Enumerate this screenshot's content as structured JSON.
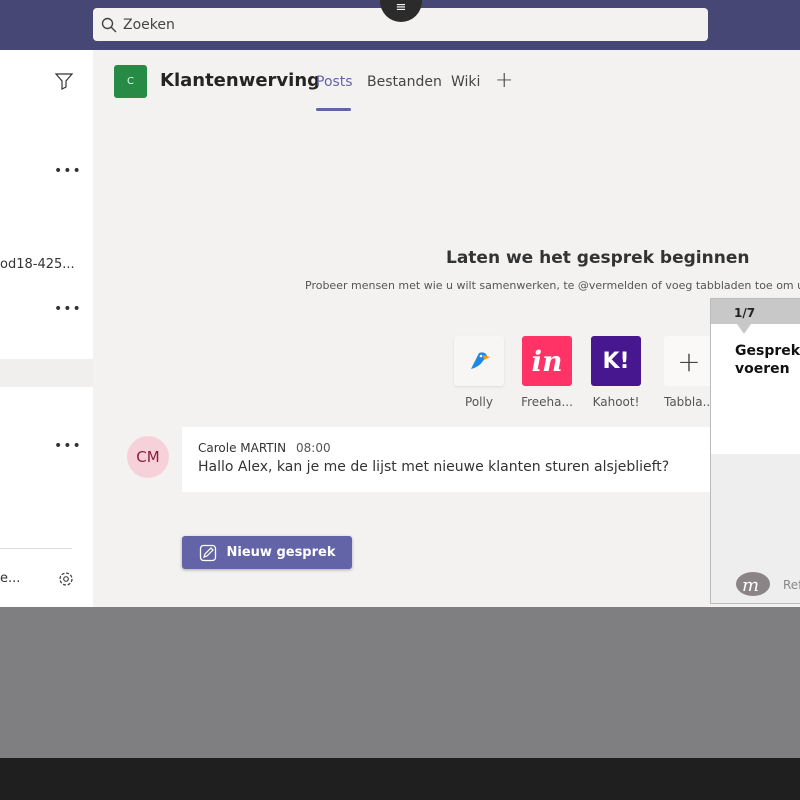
{
  "search": {
    "placeholder": "Zoeken",
    "icon": "search-icon"
  },
  "sidebar": {
    "truncated_item": "od18-425...",
    "bottom_item": "e...",
    "icons": [
      "filter-icon",
      "more-icon",
      "gear-icon"
    ]
  },
  "team": {
    "initial": "C",
    "name": "Klantenwerving",
    "color": "#278b45"
  },
  "tabs": [
    {
      "label": "Posts",
      "active": true
    },
    {
      "label": "Bestanden"
    },
    {
      "label": "Wiki"
    }
  ],
  "empty": {
    "title": "Laten we het gesprek beginnen",
    "subtitle": "Probeer mensen met wie u wilt samenwerken, te @vermelden of voeg tabbladen toe om u"
  },
  "apps": [
    {
      "label": "Polly"
    },
    {
      "label": "Freeha...",
      "glyph": "in",
      "color": "#ff3366"
    },
    {
      "label": "Kahoot!",
      "glyph": "K!",
      "color": "#46178f"
    },
    {
      "label": "Tabbla...",
      "glyph": "+"
    }
  ],
  "message": {
    "initials": "CM",
    "author": "Carole MARTIN",
    "time": "08:00",
    "text": "Hallo Alex, kan je me de lijst met nieuwe klanten sturen alsjeblieft?"
  },
  "new_conversation": "Nieuw gesprek",
  "panel": {
    "step": "1/7",
    "title_line1": "Gesprek",
    "title_line2": "voeren",
    "footer": "Ref"
  },
  "accent": "#6264a7"
}
